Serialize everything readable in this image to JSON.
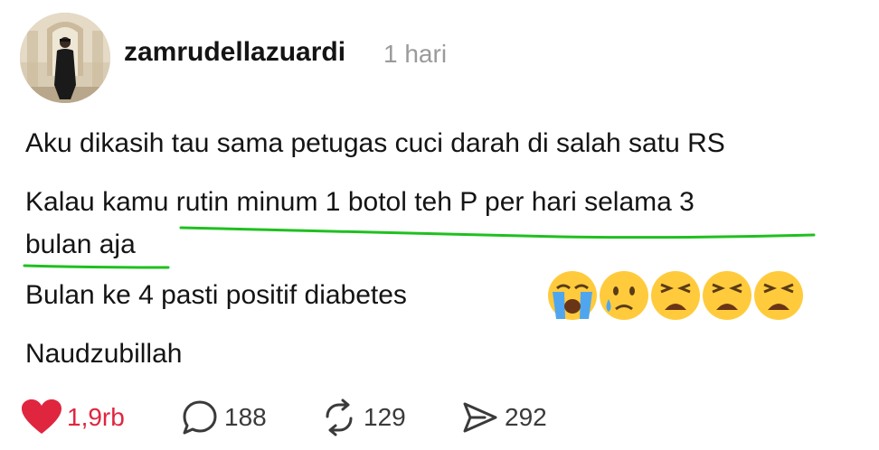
{
  "post": {
    "username": "zamrudellazuardi",
    "timestamp": "1 hari",
    "lines": [
      "Aku dikasih tau sama petugas cuci darah di salah satu RS",
      "Kalau kamu rutin minum 1 botol teh P per hari selama 3",
      "bulan aja",
      "Bulan ke 4 pasti positif diabetes",
      "Naudzubillah"
    ],
    "emojis": [
      "loudly-crying-face",
      "crying-face",
      "weary-face",
      "weary-face",
      "weary-face"
    ],
    "highlight_color": "#1fc01f"
  },
  "actions": {
    "likes": "1,9rb",
    "replies": "188",
    "reposts": "129",
    "shares": "292",
    "like_color": "#e0253f"
  }
}
